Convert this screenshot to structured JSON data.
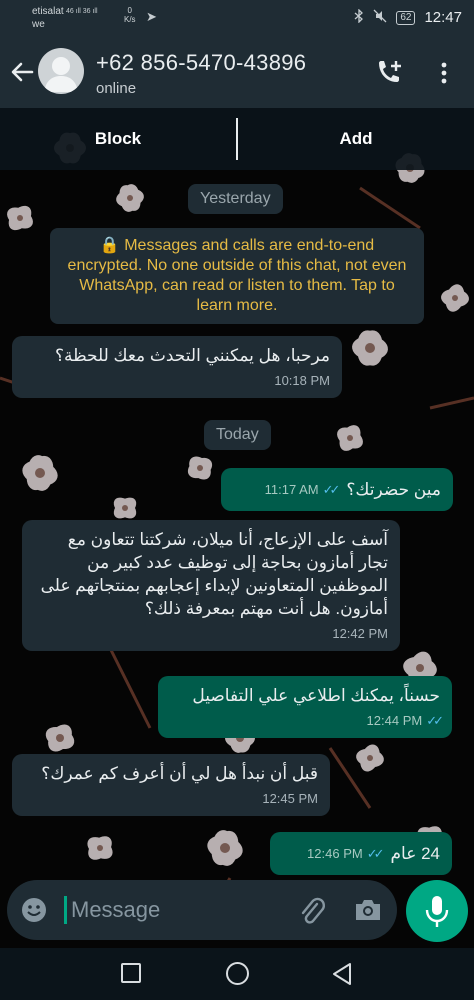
{
  "status_bar": {
    "carrier_line1": "etisalat",
    "carrier_line2": "we",
    "network": "46 ıll 36 ıll",
    "speed_value": "0",
    "speed_unit": "K/s",
    "battery": "62",
    "time": "12:47"
  },
  "header": {
    "contact_name": "+62 856-5470-43896",
    "contact_status": "online"
  },
  "actions": {
    "block_label": "Block",
    "add_label": "Add"
  },
  "chat": {
    "date_yesterday": "Yesterday",
    "encryption_notice": "🔒 Messages and calls are end-to-end encrypted. No one outside of this chat, not even WhatsApp, can read or listen to them. Tap to learn more.",
    "date_today": "Today",
    "messages": [
      {
        "direction": "incoming",
        "text": "مرحبا، هل يمكنني التحدث معك للحظة؟",
        "time": "10:18 PM"
      },
      {
        "direction": "outgoing",
        "text": "مين حضرتك؟",
        "time": "11:17 AM",
        "status": "read"
      },
      {
        "direction": "incoming",
        "text": "آسف على الإزعاج، أنا ميلان، شركتنا تتعاون مع تجار أمازون بحاجة إلى توظيف عدد كبير من الموظفين المتعاونين لإبداء إعجابهم بمنتجاتهم على أمازون. هل أنت مهتم بمعرفة ذلك؟",
        "time": "12:42 PM"
      },
      {
        "direction": "outgoing",
        "text": "حسناً، يمكنك اطلاعي علي التفاصيل",
        "time": "12:44 PM",
        "status": "read"
      },
      {
        "direction": "incoming",
        "text": "قبل أن نبدأ هل لي أن أعرف كم عمرك؟",
        "time": "12:45 PM"
      },
      {
        "direction": "outgoing",
        "text": "24 عام",
        "time": "12:46 PM",
        "status": "read"
      }
    ]
  },
  "composer": {
    "placeholder": "Message"
  },
  "colors": {
    "header_bg": "#1f2c34",
    "incoming_bubble": "#1f2c34",
    "outgoing_bubble": "#005c4b",
    "accent": "#00a884",
    "read_ticks": "#53bdeb",
    "notice_text": "#e6bb45"
  },
  "icons": [
    "back-arrow-icon",
    "avatar-placeholder-icon",
    "add-call-icon",
    "more-vert-icon",
    "emoji-icon",
    "attach-icon",
    "camera-icon",
    "mic-icon",
    "nav-recents-icon",
    "nav-home-icon",
    "nav-back-icon",
    "bluetooth-icon",
    "mute-icon"
  ]
}
